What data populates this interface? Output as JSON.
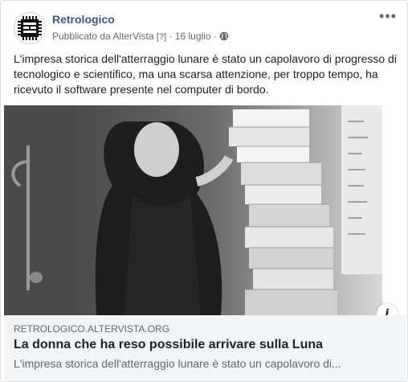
{
  "post": {
    "page_name": "Retrologico",
    "published_by_prefix": "Pubblicato da",
    "published_by": "AlterVista",
    "help_marker": "[?]",
    "separator": "·",
    "date": "16 luglio",
    "separator2": "·",
    "privacy_icon": "globe-icon",
    "more_icon": "more-options-icon",
    "more_glyph": "•••",
    "text": "L'impresa storica dell'atterraggio lunare è stato un capolavoro di progresso di tecnologico e scientifico, ma una scarsa attenzione, per troppo tempo, ha ricevuto il software presente nel computer di bordo."
  },
  "link_preview": {
    "info_glyph": "i",
    "domain": "RETROLOGICO.ALTERVISTA.ORG",
    "title": "La donna che ha reso possibile arrivare sulla Luna",
    "description": "L'impresa storica dell'atterraggio lunare è stato un capolavoro di..."
  },
  "colors": {
    "page_name": "#385898",
    "meta_text": "#606770",
    "body_text": "#1c1e21",
    "preview_bg": "#f2f3f5"
  }
}
